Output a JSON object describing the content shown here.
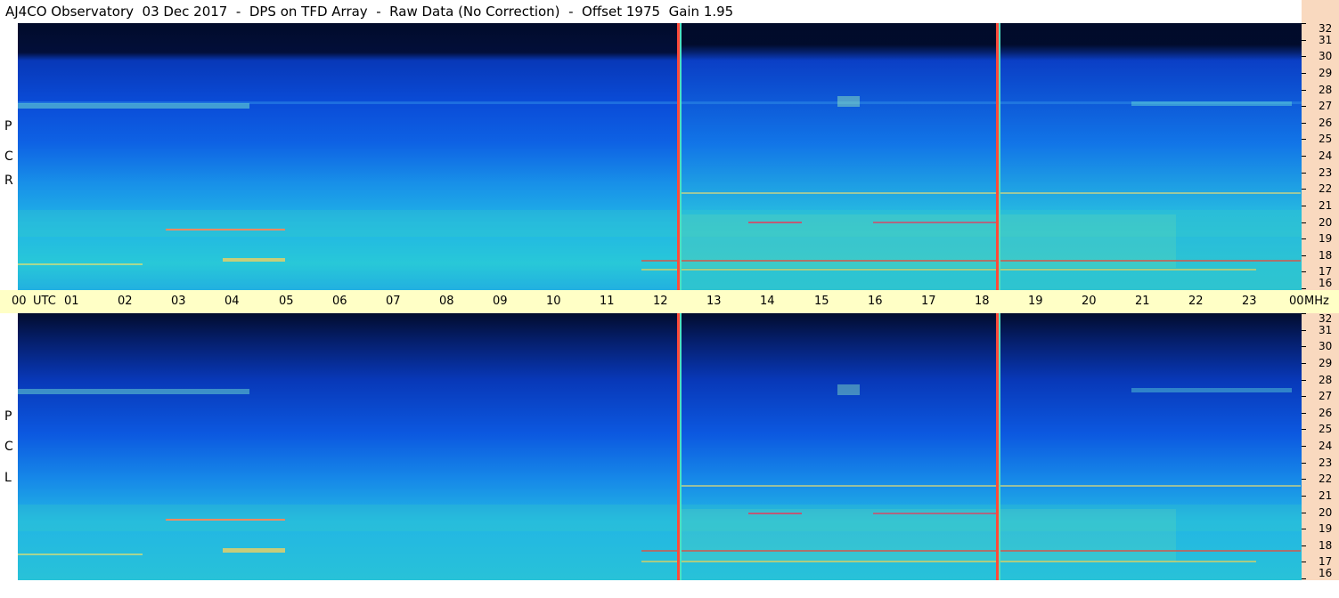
{
  "title": "AJ4CO Observatory  03 Dec 2017  -  DPS on TFD Array  -  Raw Data (No Correction)  -  Offset 1975  Gain 1.95",
  "panels": [
    {
      "id": "rcp",
      "label_letters": [
        "R",
        "C",
        "P"
      ]
    },
    {
      "id": "lcp",
      "label_letters": [
        "L",
        "C",
        "P"
      ]
    }
  ],
  "time_axis": {
    "labels": [
      "00",
      "UTC",
      "01",
      "02",
      "03",
      "04",
      "05",
      "06",
      "07",
      "08",
      "09",
      "10",
      "11",
      "12",
      "13",
      "14",
      "15",
      "16",
      "17",
      "18",
      "19",
      "20",
      "21",
      "22",
      "23",
      "00",
      "MHz"
    ]
  },
  "freq_axis": {
    "labels": [
      "32",
      "31",
      "30",
      "29",
      "28",
      "27",
      "26",
      "25",
      "24",
      "23",
      "22",
      "21",
      "20",
      "19",
      "18",
      "17",
      "16"
    ],
    "unit": "MHz"
  },
  "colors": {
    "background_dark": "#010b2a",
    "deep_blue": "#0838b8",
    "mid_blue": "#1068e8",
    "cyan": "#20b8e8",
    "green_cyan": "#38d8c0",
    "time_axis_bg": "#ffffc6",
    "freq_axis_bg": "#f9d9bf"
  }
}
